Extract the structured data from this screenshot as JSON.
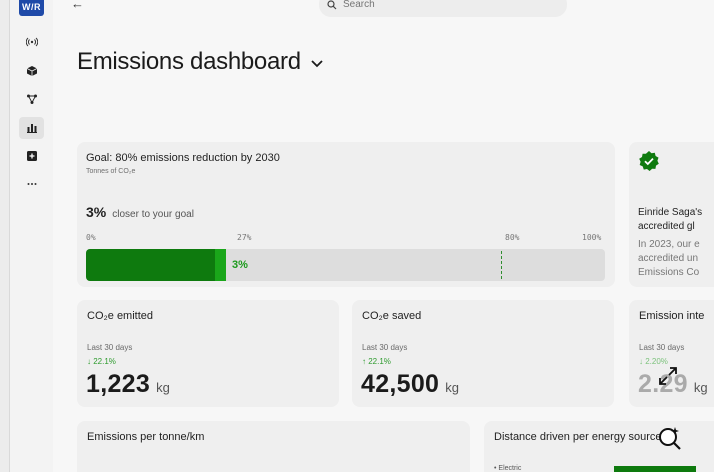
{
  "app": {
    "logo_text": "W/R"
  },
  "sidebar": {
    "items": [
      {
        "icon": "broadcast-icon"
      },
      {
        "icon": "package-icon"
      },
      {
        "icon": "network-icon"
      },
      {
        "icon": "bar-chart-icon",
        "active": true
      },
      {
        "icon": "add-box-icon"
      },
      {
        "icon": "more-icon"
      }
    ]
  },
  "header": {
    "back_label": "←",
    "search_placeholder": "Search",
    "title": "Emissions dashboard"
  },
  "goal_card": {
    "title": "Goal: 80% emissions reduction by 2030",
    "subtitle": "Tonnes of CO₂e",
    "progress_big": "3%",
    "progress_text": "closer to your goal",
    "ticks": [
      "0%",
      "27%",
      "80%",
      "100%"
    ],
    "progress_value": 0.27,
    "target_value": 0.8,
    "bar_label": "3%",
    "color_fill": "#0e7a0e",
    "color_accent": "#1aa61a"
  },
  "info_card": {
    "heading_lines": [
      "Einride Saga's",
      "accredited gl"
    ],
    "body_lines": [
      "In 2023, our e",
      "accredited un",
      "Emissions Co"
    ]
  },
  "metrics": [
    {
      "title": "CO₂e emitted",
      "period": "Last 30 days",
      "change": "↓ 22.1%",
      "change_color": "#2e9b2e",
      "value": "1,223",
      "unit": "kg"
    },
    {
      "title": "CO₂e saved",
      "period": "Last 30 days",
      "change": "↑ 22.1%",
      "change_color": "#2e9b2e",
      "value": "42,500",
      "unit": "kg"
    },
    {
      "title": "Emission inte",
      "period": "Last 30 days",
      "change": "↓ 2.20%",
      "change_color": "#2e9b2e",
      "value": "2.29",
      "unit": "kg"
    }
  ],
  "bottom_cards": {
    "per_tonne_title": "Emissions per tonne/km",
    "distance_title": "Distance driven per energy source",
    "legend_electric": "• Electric"
  }
}
